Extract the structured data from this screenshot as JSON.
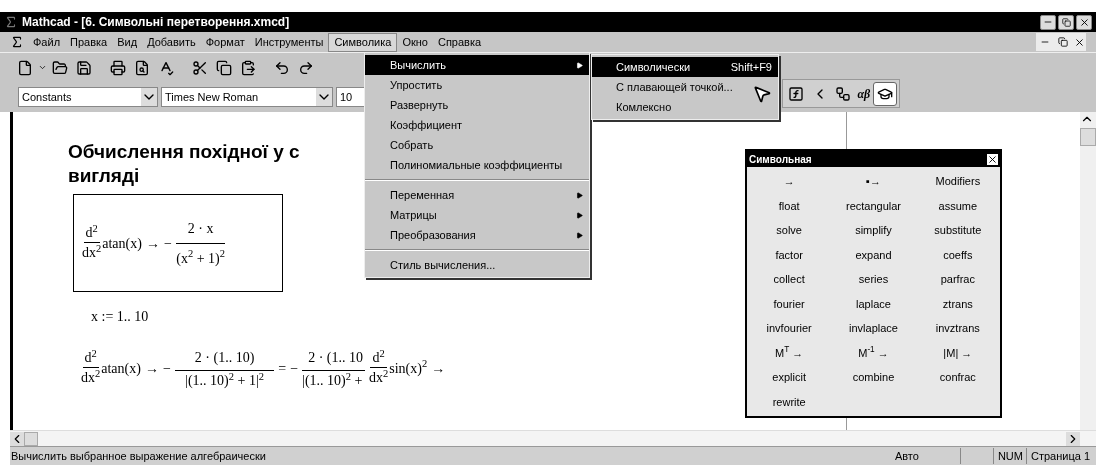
{
  "window": {
    "title": "Mathcad - [6. Символьні перетворення.xmcd]"
  },
  "menu_bar": [
    {
      "label": "Файл",
      "selected": false
    },
    {
      "label": "Правка",
      "selected": false
    },
    {
      "label": "Вид",
      "selected": false
    },
    {
      "label": "Добавить",
      "selected": false
    },
    {
      "label": "Формат",
      "selected": false
    },
    {
      "label": "Инструменты",
      "selected": false
    },
    {
      "label": "Символика",
      "selected": true
    },
    {
      "label": "Окно",
      "selected": false
    },
    {
      "label": "Справка",
      "selected": false
    }
  ],
  "format_toolbar": {
    "style": "Constants",
    "font": "Times New Roman",
    "size": "10"
  },
  "math_toolbar": {
    "greek_label": "αβ",
    "symbolic_pressed": true
  },
  "symbolics_menu": [
    {
      "kind": "item",
      "label": "Вычислить",
      "submenu": true,
      "selected": true
    },
    {
      "kind": "item",
      "label": "Упростить",
      "submenu": false,
      "selected": false
    },
    {
      "kind": "item",
      "label": "Развернуть",
      "submenu": false,
      "selected": false
    },
    {
      "kind": "item",
      "label": "Коэффициент",
      "submenu": false,
      "selected": false
    },
    {
      "kind": "item",
      "label": "Собрать",
      "submenu": false,
      "selected": false
    },
    {
      "kind": "item",
      "label": "Полиномиальные коэффициенты",
      "submenu": false,
      "selected": false
    },
    {
      "kind": "separator"
    },
    {
      "kind": "item",
      "label": "Переменная",
      "submenu": true,
      "selected": false
    },
    {
      "kind": "item",
      "label": "Матрицы",
      "submenu": true,
      "selected": false
    },
    {
      "kind": "item",
      "label": "Преобразования",
      "submenu": true,
      "selected": false
    },
    {
      "kind": "separator"
    },
    {
      "kind": "item",
      "label": "Стиль вычисления...",
      "submenu": false,
      "selected": false
    }
  ],
  "evaluate_submenu": [
    {
      "label": "Символически",
      "shortcut": "Shift+F9",
      "selected": true
    },
    {
      "label": "С плавающей точкой...",
      "selected": false
    },
    {
      "label": "Комлексно",
      "selected": false
    }
  ],
  "document": {
    "heading_lines": [
      "Обчислення похідної у с",
      "вигляді"
    ],
    "formula_1": {
      "d": "d$^{2}$",
      "dx": "dx$^{2}$",
      "function": "atan(x)",
      "arrow": "→",
      "sign": "−",
      "numerator": "2 · x",
      "denominator": "(x$^{2}$ + 1)$^{2}$"
    },
    "range_definition": "x := 1.. 10",
    "formula_2": {
      "d": "d$^{2}$",
      "dx": "dx$^{2}$",
      "function": "atan(x)",
      "arrow": "→",
      "sign": "−",
      "numerator": "2 · (1.. 10)",
      "denominator": "|(1.. 10)$^{2}$ + 1|$^{2}$",
      "equals": "=",
      "sign_2": "−",
      "numerator_2": "2 · (1.. 10",
      "denominator_2": "|(1.. 10)$^{2}$ +"
    },
    "formula_3": {
      "d": "d$^{2}$",
      "dx": "dx$^{2}$",
      "function": "sin(x)$^{2}$",
      "arrow": "→"
    }
  },
  "symbolic_palette": {
    "title": "Символьная",
    "buttons": [
      "→",
      "▪→",
      "Modifiers",
      "float",
      "rectangular",
      "assume",
      "solve",
      "simplify",
      "substitute",
      "factor",
      "expand",
      "coeffs",
      "collect",
      "series",
      "parfrac",
      "fourier",
      "laplace",
      "ztrans",
      "invfourier",
      "invlaplace",
      "invztrans",
      "M$^{T}$ →",
      "M$^{-1}$ →",
      "|M| →",
      "explicit",
      "combine",
      "confrac",
      "rewrite"
    ]
  },
  "status_bar": {
    "message": "Вычислить выбранное выражение алгебраически",
    "mode": "Авто",
    "num": "NUM",
    "page": "Страница 1"
  }
}
